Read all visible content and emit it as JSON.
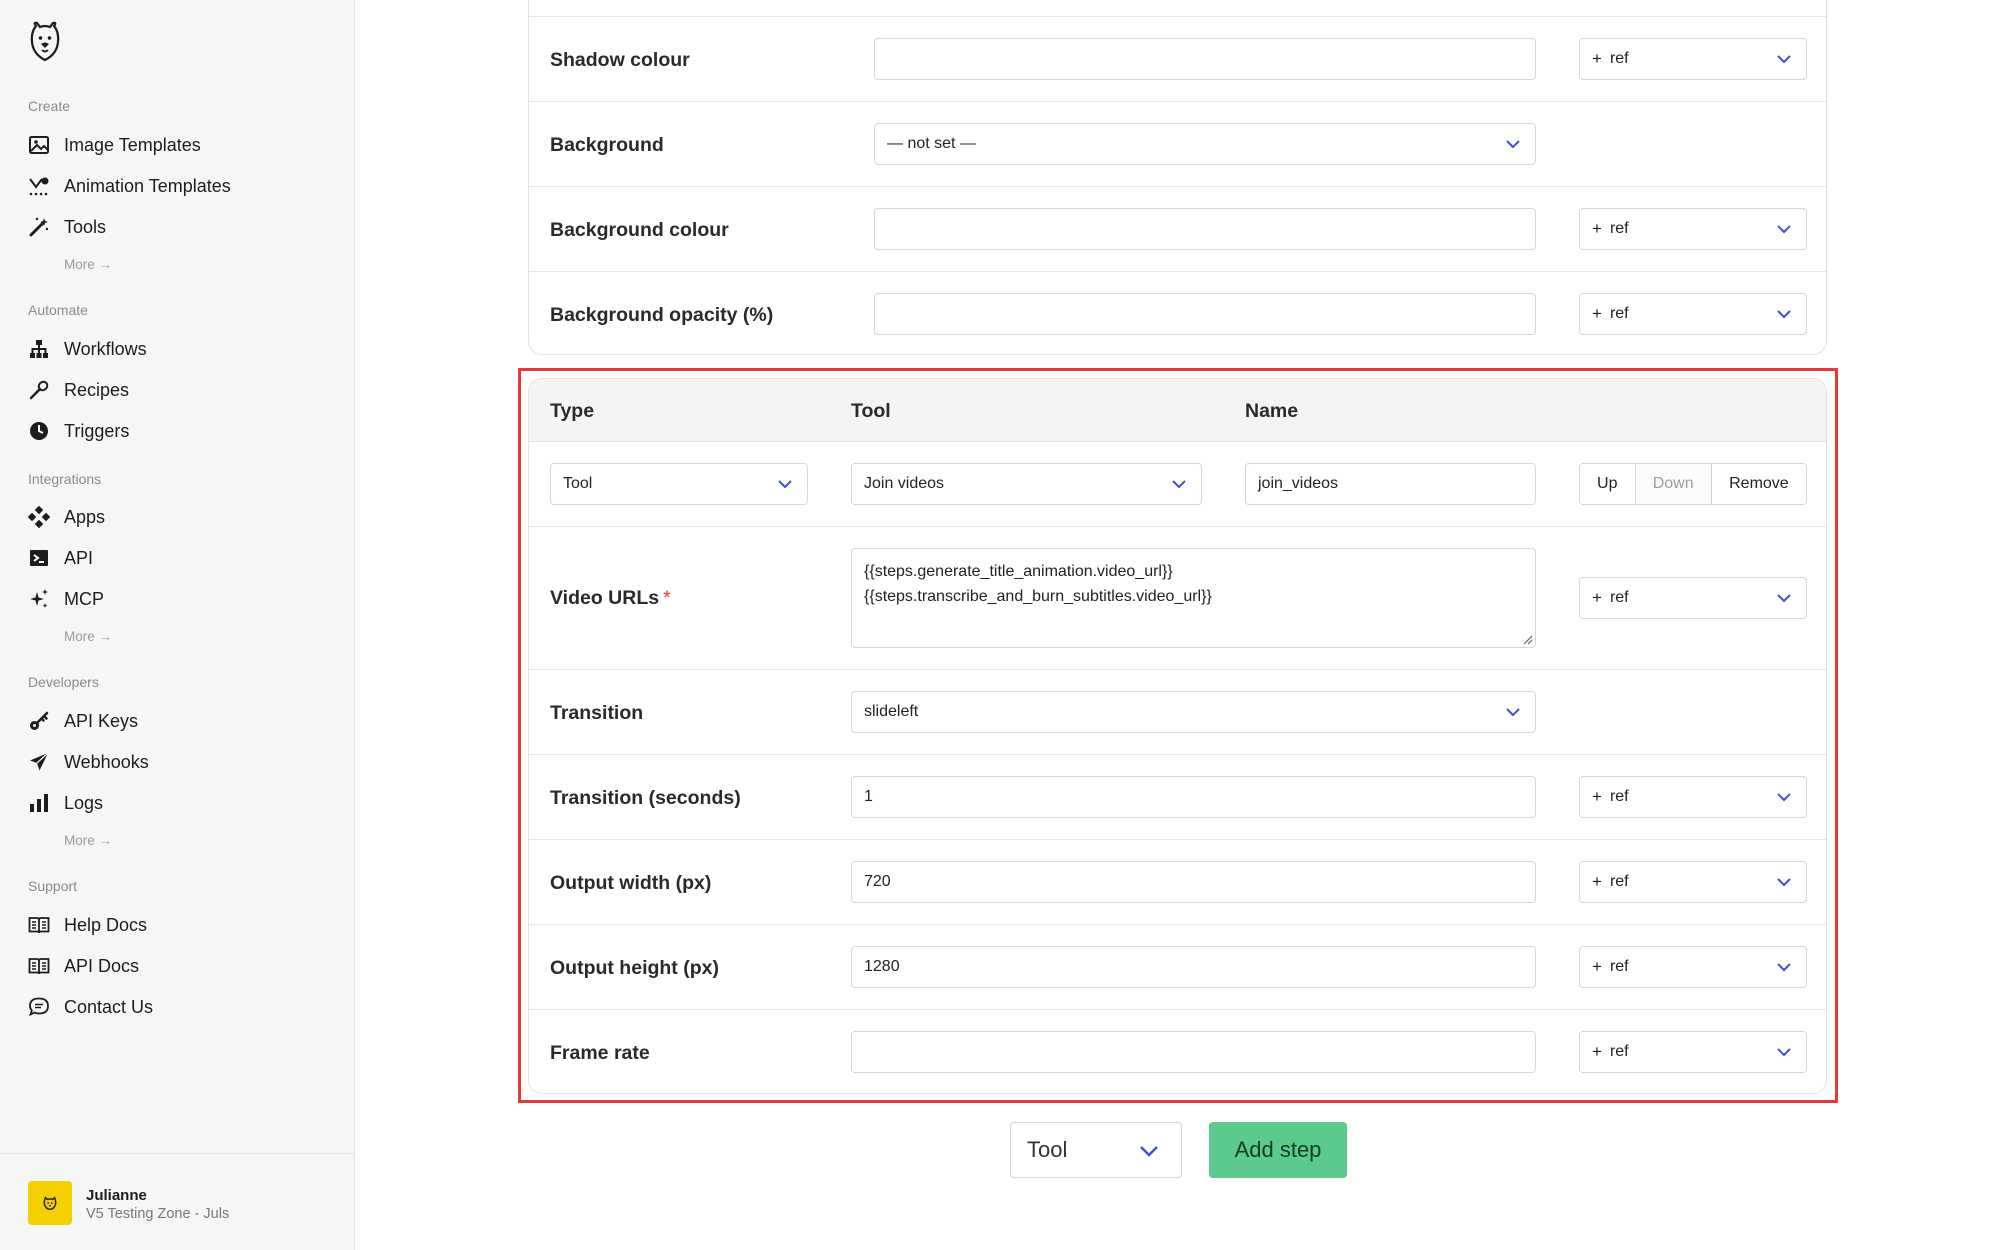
{
  "sidebar": {
    "sections": {
      "create": "Create",
      "automate": "Automate",
      "integrations": "Integrations",
      "developers": "Developers",
      "support": "Support"
    },
    "items": {
      "image_templates": "Image Templates",
      "animation_templates": "Animation Templates",
      "tools": "Tools",
      "workflows": "Workflows",
      "recipes": "Recipes",
      "triggers": "Triggers",
      "apps": "Apps",
      "api": "API",
      "mcp": "MCP",
      "api_keys": "API Keys",
      "webhooks": "Webhooks",
      "logs": "Logs",
      "help_docs": "Help Docs",
      "api_docs": "API Docs",
      "contact_us": "Contact Us"
    },
    "more_label": "More →",
    "account": {
      "name": "Julianne",
      "team": "V5 Testing Zone - Juls"
    }
  },
  "top_card": {
    "rows": [
      {
        "label": "Shadow colour",
        "value": "",
        "ref": "ref"
      },
      {
        "label": "Background",
        "select_value": "— not set —"
      },
      {
        "label": "Background colour",
        "value": "",
        "ref": "ref"
      },
      {
        "label": "Background opacity (%)",
        "value": "",
        "ref": "ref"
      }
    ]
  },
  "step": {
    "headers": {
      "type": "Type",
      "tool": "Tool",
      "name": "Name"
    },
    "type_value": "Tool",
    "tool_value": "Join videos",
    "name_value": "join_videos",
    "buttons": {
      "up": "Up",
      "down": "Down",
      "remove": "Remove"
    },
    "fields": {
      "video_urls": {
        "label": "Video URLs",
        "required_mark": "*",
        "lines": [
          "{{steps.generate_title_animation.video_url}}",
          "{{steps.transcribe_and_burn_subtitles.video_url}}"
        ],
        "ref": "ref"
      },
      "transition": {
        "label": "Transition",
        "value": "slideleft"
      },
      "transition_seconds": {
        "label": "Transition (seconds)",
        "value": "1",
        "ref": "ref"
      },
      "output_width": {
        "label": "Output width (px)",
        "value": "720",
        "ref": "ref"
      },
      "output_height": {
        "label": "Output height (px)",
        "value": "1280",
        "ref": "ref"
      },
      "frame_rate": {
        "label": "Frame rate",
        "value": "",
        "ref": "ref"
      }
    }
  },
  "footer": {
    "step_type": "Tool",
    "add_step": "Add step"
  },
  "colors": {
    "accent": "#5cc98e",
    "highlight": "#e53935",
    "chevron": "#3d4fd6",
    "avatar": "#f5d000"
  }
}
